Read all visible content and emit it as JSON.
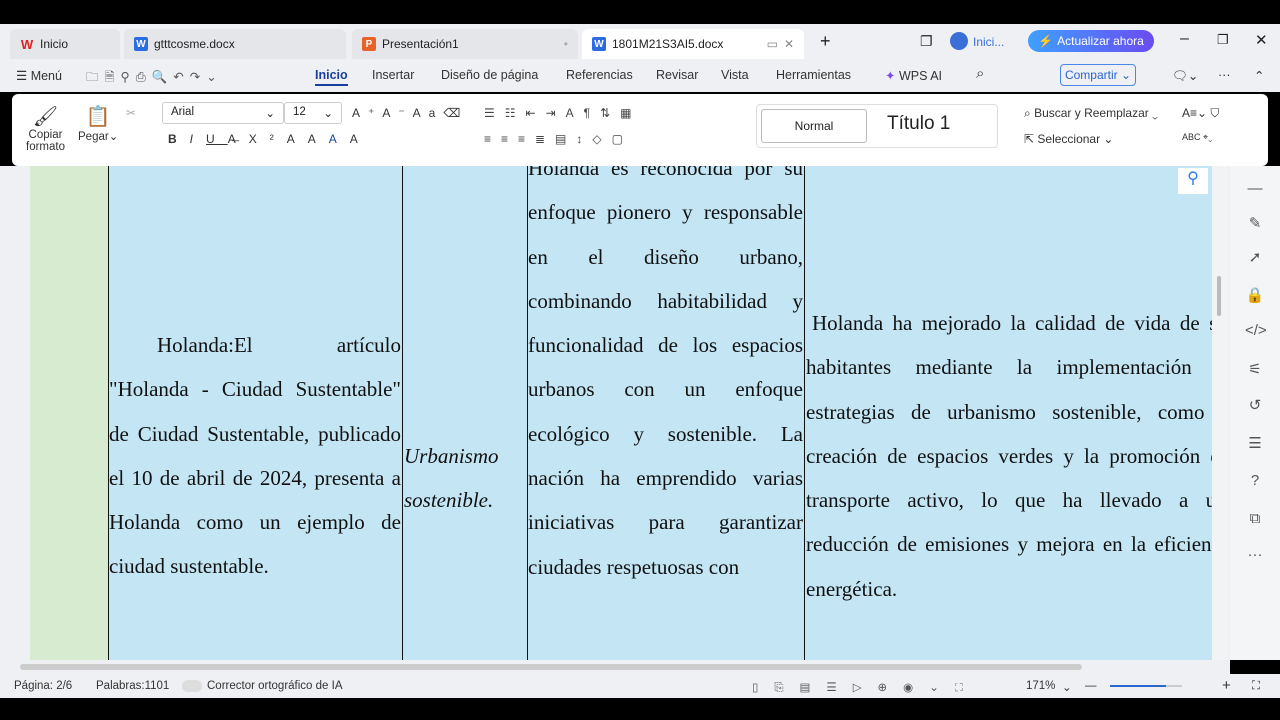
{
  "tabs": [
    {
      "label": "Inicio",
      "icon": "wps-icon"
    },
    {
      "label": "gtttcosme.docx",
      "icon": "word-icon"
    },
    {
      "label": "Presentación1",
      "icon": "ppt-icon"
    },
    {
      "label": "1801M21S3AI5.docx",
      "icon": "word-icon",
      "active": true
    }
  ],
  "titlebar": {
    "user": "Inici...",
    "upgrade": "Actualizar ahora"
  },
  "menu": {
    "menu": "Menú",
    "items": [
      "Inicio",
      "Insertar",
      "Diseño de página",
      "Referencias",
      "Revisar",
      "Vista",
      "Herramientas"
    ],
    "wps_ai": "WPS AI",
    "share": "Compartir"
  },
  "ribbon": {
    "copy_format": "Copiar",
    "copy_format2": "formato",
    "paste": "Pegar",
    "font": "Arial",
    "size": "12",
    "style_normal": "Normal",
    "style_title": "Título 1",
    "find_replace": "Buscar y Reemplazar",
    "select": "Seleccionar"
  },
  "document": {
    "col1": "Holanda:El artículo \"Holanda - Ciudad Sustentable\" de Ciudad Sustentable, publicado el 10 de abril de 2024, presenta a Holanda como un ejemplo de ciudad sustentable.",
    "col2": "Urbanismo sostenible.",
    "col3": "Holanda es reconocida por su enfoque pionero y responsable en el diseño urbano, combinando habitabilidad y funcionalidad de los espacios urbanos con un enfoque ecológico y sostenible. La nación ha emprendido varias iniciativas para garantizar ciudades respetuosas con",
    "col4": "Holanda ha mejorado la calidad de vida de sus habitantes mediante la implementación de estrategias de urbanismo sostenible, como la creación de espacios verdes y la promoción del transporte activo, lo que ha llevado a una reducción de emisiones y mejora en la eficiencia energética."
  },
  "status": {
    "page": "Página: 2/6",
    "words": "Palabras:1101",
    "spell": "Corrector ortográfico de IA",
    "zoom": "171%"
  },
  "colors": {
    "accent": "#1a5fd6",
    "cell": "#c3e5f4"
  }
}
